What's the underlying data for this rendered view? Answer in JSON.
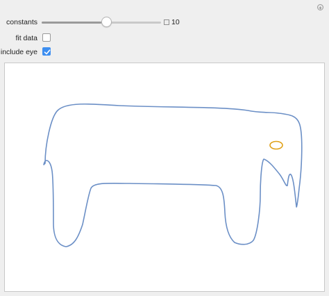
{
  "controls": {
    "constants": {
      "label": "constants",
      "value": "10",
      "fraction": 0.5
    },
    "fit_data": {
      "label": "fit data",
      "checked": false
    },
    "include_eye": {
      "label": "include eye",
      "checked": true
    }
  },
  "plot": {
    "body_color": "#6b8fc6",
    "eye_color": "#e0a118"
  },
  "icons": {
    "add": "plus-circle-icon",
    "animate": "animation-toggle-icon",
    "check": "checkmark-icon"
  }
}
